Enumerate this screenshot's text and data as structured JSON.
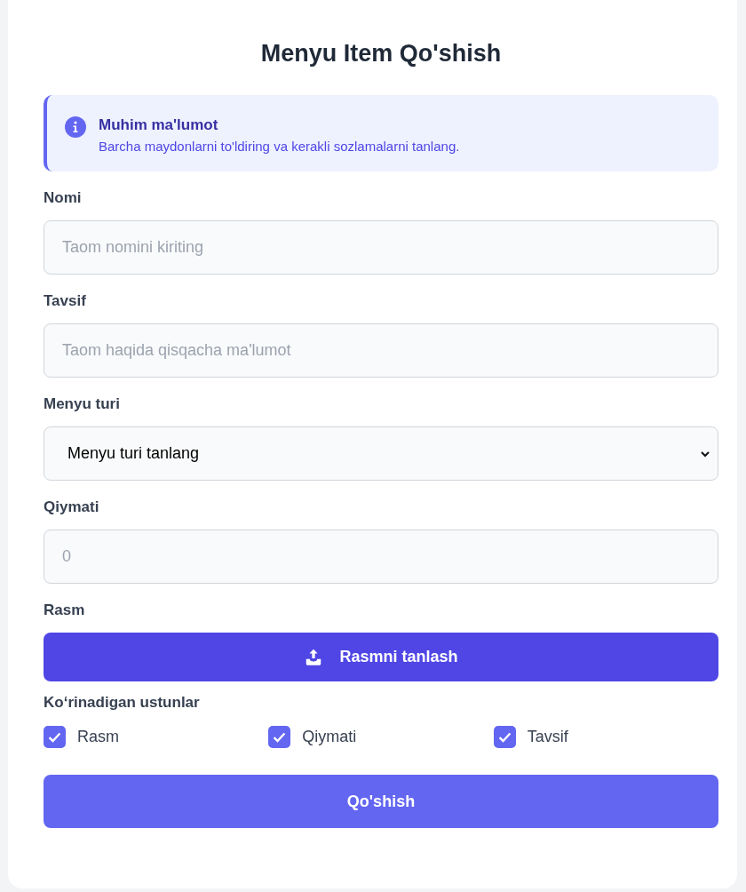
{
  "title": "Menyu Item Qo'shish",
  "alert": {
    "title": "Muhim ma'lumot",
    "text": "Barcha maydonlarni to'ldiring va kerakli sozlamalarni tanlang."
  },
  "fields": [
    {
      "label": "Nomi",
      "kind": "input",
      "placeholder": "Taom nomini kiriting"
    },
    {
      "label": "Tavsif",
      "kind": "input",
      "placeholder": "Taom haqida qisqacha ma'lumot"
    },
    {
      "label": "Menyu turi",
      "kind": "select",
      "value": "Menyu turi tanlang"
    },
    {
      "label": "Qiymati",
      "kind": "input",
      "placeholder": "0"
    },
    {
      "label": "Rasm",
      "kind": "upload",
      "button": "Rasmni tanlash"
    }
  ],
  "columns": {
    "label": "Ko‘rinadigan ustunlar",
    "items": [
      {
        "label": "Rasm",
        "checked": true
      },
      {
        "label": "Qiymati",
        "checked": true
      },
      {
        "label": "Tavsif",
        "checked": true
      }
    ]
  },
  "submit": "Qo'shish"
}
